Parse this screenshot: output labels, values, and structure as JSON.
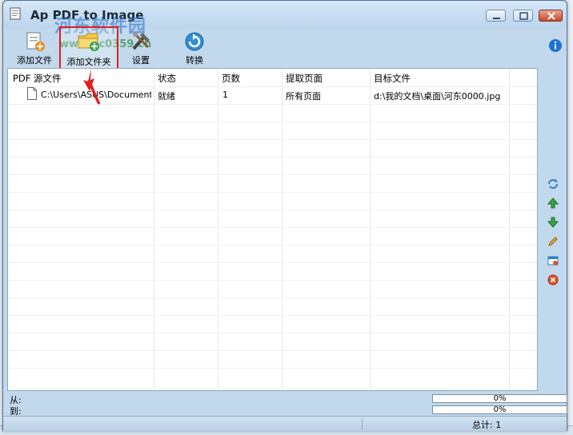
{
  "window": {
    "title": "Ap PDF to Image",
    "watermark": "河东软件园",
    "watermark_url": "www.pc0359.cn"
  },
  "toolbar": {
    "add_file": "添加文件",
    "add_folder": "添加文件夹",
    "settings": "设置",
    "convert": "转换"
  },
  "table": {
    "columns": [
      "PDF 源文件",
      "状态",
      "页数",
      "提取页面",
      "目标文件"
    ],
    "rows": [
      {
        "source": "C:\\Users\\ASUS\\Document...",
        "status": "就绪",
        "pages": "1",
        "extract": "所有页面",
        "target": "d:\\我的文档\\桌面\\河东0000.jpg"
      }
    ]
  },
  "progress": {
    "from_label": "从:",
    "to_label": "到:",
    "from_value": "0%",
    "to_value": "0%"
  },
  "status": {
    "total": "总计: 1"
  },
  "colors": {
    "highlight": "#e01e1e",
    "window_bg": "#c2d8ec"
  }
}
